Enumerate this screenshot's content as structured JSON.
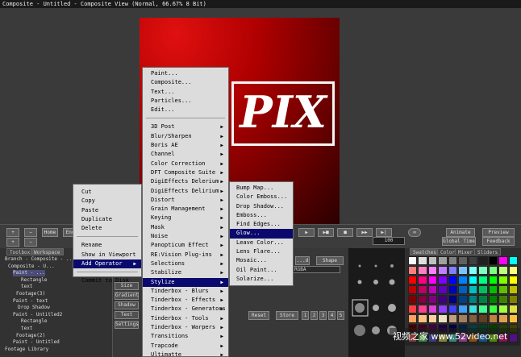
{
  "window": {
    "title": "Composite - Untitled - Composite View (Normal, 66.67% 8 Bit)"
  },
  "canvas": {
    "logo_text": "PIX"
  },
  "controls": {
    "home": "Home",
    "end": "End",
    "frame_value": "100",
    "animate": "Animate",
    "preview": "Preview",
    "global_time": "Global Time",
    "feedback": "Feedback"
  },
  "left_panel": {
    "tabs": [
      "Toolbox",
      "Workspace"
    ],
    "tree": [
      {
        "label": "Branch - Composite - ...",
        "selected": false
      },
      {
        "label": "Composite - U...",
        "selected": false
      },
      {
        "label": "Paint - ...",
        "selected": true
      },
      {
        "label": "Rectangle",
        "selected": false
      },
      {
        "label": "text",
        "selected": false
      },
      {
        "label": "Footage(3)",
        "selected": false
      },
      {
        "label": "Paint - text",
        "selected": false
      },
      {
        "label": "Drop Shadow",
        "selected": false
      },
      {
        "label": "Paint - Untitled2",
        "selected": false
      },
      {
        "label": "Rectangle",
        "selected": false
      },
      {
        "label": "text",
        "selected": false
      },
      {
        "label": "Footage(2)",
        "selected": false
      },
      {
        "label": "Paint - Untitled",
        "selected": false
      },
      {
        "label": "Footage Library",
        "selected": false
      }
    ]
  },
  "mid_panel": {
    "side_buttons": [
      "Size",
      "Gradient",
      "Shadow",
      "Text",
      "Settings"
    ],
    "dropdown1": "...d",
    "dropdown2": "Shape",
    "dropdown3": "RGBA",
    "reset": "Reset",
    "store": "Store",
    "slots": [
      "1",
      "2",
      "3",
      "4",
      "5"
    ]
  },
  "swatch_panel": {
    "tabs": [
      "Swatches",
      "Color",
      "Mixer",
      "Sliders"
    ],
    "colors": [
      "#ffffff",
      "#e0e0e0",
      "#c0c0c0",
      "#a0a0a0",
      "#808080",
      "#606060",
      "#404040",
      "#202020",
      "#000000",
      "#ff00ff",
      "#00ffff",
      "#ff8080",
      "#ff80c0",
      "#ff80ff",
      "#c080ff",
      "#8080ff",
      "#80c0ff",
      "#80ffff",
      "#80ffc0",
      "#80ff80",
      "#c0ff80",
      "#ffff80",
      "#ff0000",
      "#ff0080",
      "#ff00ff",
      "#8000ff",
      "#0000ff",
      "#0080ff",
      "#00ffff",
      "#00ff80",
      "#00ff00",
      "#80ff00",
      "#ffff00",
      "#c00000",
      "#c00060",
      "#c000c0",
      "#6000c0",
      "#0000c0",
      "#0060c0",
      "#00c0c0",
      "#00c060",
      "#00c000",
      "#60c000",
      "#c0c000",
      "#800000",
      "#800040",
      "#800080",
      "#400080",
      "#000080",
      "#004080",
      "#008080",
      "#008040",
      "#008000",
      "#408000",
      "#808000",
      "#ff4040",
      "#ff4090",
      "#e040e0",
      "#9040ff",
      "#4040ff",
      "#40a0ff",
      "#40e0e0",
      "#40ff90",
      "#40ff40",
      "#a0ff40",
      "#e0e040",
      "#ffa060",
      "#ffc080",
      "#ffd0a0",
      "#f0e0c0",
      "#c0a080",
      "#a08060",
      "#806040",
      "#604020",
      "#c08040",
      "#e0a050",
      "#ffc040",
      "#400000",
      "#400020",
      "#400040",
      "#200040",
      "#000040",
      "#002040",
      "#004040",
      "#004020",
      "#004000",
      "#204000",
      "#404000",
      "#ff6060",
      "#60ff60",
      "#6060ff",
      "#ffff60",
      "#60ffff",
      "#ff60ff",
      "#ff9000",
      "#0090ff",
      "#90ff00",
      "#ff0090",
      "#9000ff"
    ]
  },
  "context_menu": {
    "items": [
      "Cut",
      "Copy",
      "Paste",
      "Duplicate",
      "Delete",
      "Rename",
      "Show in Viewport",
      "Add Operator",
      "Commit to Disk"
    ]
  },
  "operator_menu": {
    "items": [
      {
        "label": "Paint...",
        "arrow": false
      },
      {
        "label": "Composite...",
        "arrow": false
      },
      {
        "label": "Text...",
        "arrow": false
      },
      {
        "label": "Particles...",
        "arrow": false
      },
      {
        "label": "Edit...",
        "arrow": false
      },
      {
        "label": "3D Post",
        "arrow": true
      },
      {
        "label": "Blur/Sharpen",
        "arrow": true
      },
      {
        "label": "Boris AE",
        "arrow": true
      },
      {
        "label": "Channel",
        "arrow": true
      },
      {
        "label": "Color Correction",
        "arrow": true
      },
      {
        "label": "DFT Composite Suite",
        "arrow": true
      },
      {
        "label": "DigiEffects Delerium",
        "arrow": true
      },
      {
        "label": "DigiEffects Delirium",
        "arrow": true
      },
      {
        "label": "Distort",
        "arrow": true
      },
      {
        "label": "Grain Management",
        "arrow": true
      },
      {
        "label": "Keying",
        "arrow": true
      },
      {
        "label": "Mask",
        "arrow": true
      },
      {
        "label": "Noise",
        "arrow": true
      },
      {
        "label": "Panopticum Effect",
        "arrow": true
      },
      {
        "label": "RE:Vision Plug-ins",
        "arrow": true
      },
      {
        "label": "Selections",
        "arrow": true
      },
      {
        "label": "Stabilize",
        "arrow": true
      },
      {
        "label": "Stylize",
        "arrow": true
      },
      {
        "label": "Tinderbox - Blurs",
        "arrow": true
      },
      {
        "label": "Tinderbox - Effects",
        "arrow": true
      },
      {
        "label": "Tinderbox - Generators",
        "arrow": true
      },
      {
        "label": "Tinderbox - Tools",
        "arrow": true
      },
      {
        "label": "Tinderbox - Warpers",
        "arrow": true
      },
      {
        "label": "Transitions",
        "arrow": true
      },
      {
        "label": "Trapcode",
        "arrow": true
      },
      {
        "label": "Ultimatte",
        "arrow": true
      }
    ]
  },
  "stylize_menu": {
    "items": [
      "Bump Map...",
      "Color Emboss...",
      "Drop Shadow...",
      "Emboss...",
      "Find Edges...",
      "Glow...",
      "Leave Color...",
      "Lens Flare...",
      "Mosaic...",
      "Oil Paint...",
      "Solarize..."
    ]
  },
  "watermark": {
    "text": "视频之家 www.52video.net"
  }
}
